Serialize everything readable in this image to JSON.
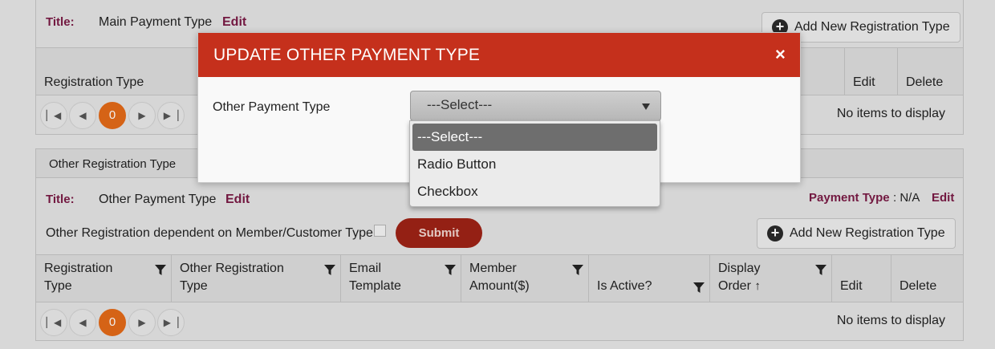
{
  "main_section": {
    "title_label": "Title:",
    "title_value": "Main Payment Type",
    "edit_label": "Edit",
    "add_button": "Add New Registration Type",
    "columns": [
      "Registration Type",
      "Edit",
      "Delete"
    ],
    "page_number": "0",
    "no_items": "No items to display"
  },
  "other_section": {
    "header": "Other Registration Type",
    "title_label": "Title:",
    "title_value": "Other Payment Type",
    "edit_label": "Edit",
    "payment_type_label": "Payment Type",
    "payment_type_value": ": N/A",
    "payment_edit": "Edit",
    "dependent_label": "Other Registration dependent on Member/Customer Type",
    "submit_label": "Submit",
    "add_button": "Add New Registration Type",
    "columns": [
      {
        "line1": "Registration",
        "line2": "Type"
      },
      {
        "line1": "Other Registration",
        "line2": "Type"
      },
      {
        "line1": "Email",
        "line2": "Template"
      },
      {
        "line1": "Member",
        "line2": "Amount($)"
      },
      {
        "line1": "",
        "line2": "Is Active?"
      },
      {
        "line1": "Display",
        "line2": "Order"
      },
      {
        "line1": "",
        "line2": "Edit"
      },
      {
        "line1": "",
        "line2": "Delete"
      }
    ],
    "page_number": "0",
    "no_items": "No items to display"
  },
  "modal": {
    "title": "UPDATE OTHER PAYMENT TYPE",
    "close_glyph": "×",
    "field_label": "Other Payment Type",
    "select_value": "---Select---",
    "options": [
      "---Select---",
      "Radio Button",
      "Checkbox"
    ]
  },
  "colors": {
    "modal_header": "#c5301c",
    "accent_link": "#7a1a45",
    "pager_active": "#e36a18",
    "submit": "#9e2316"
  },
  "icons": [
    "plus-circle-icon",
    "filter-icon",
    "sort-up-icon",
    "first-page-icon",
    "prev-page-icon",
    "next-page-icon",
    "last-page-icon",
    "close-icon",
    "dropdown-arrow-icon"
  ]
}
